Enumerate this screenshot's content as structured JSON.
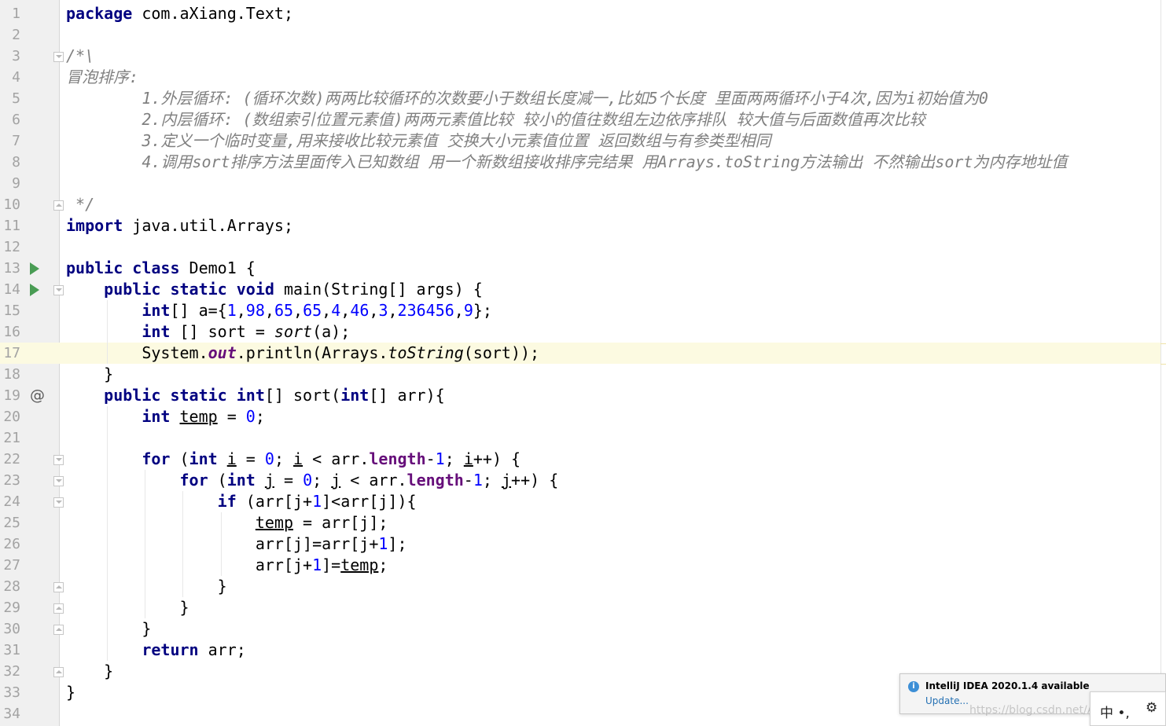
{
  "editor": {
    "language": "java",
    "current_line": 17,
    "lines": [
      {
        "n": "1",
        "t": "package com.aXiang.Text;"
      },
      {
        "n": "2",
        "t": ""
      },
      {
        "n": "3",
        "t": "/*\\"
      },
      {
        "n": "4",
        "t": "冒泡排序:"
      },
      {
        "n": "5",
        "t": "        1.外层循环: (循环次数)两两比较循环的次数要小于数组长度减一,比如5个长度 里面两两循环小于4次,因为i初始值为0"
      },
      {
        "n": "6",
        "t": "        2.内层循环: (数组索引位置元素值)两两元素值比较 较小的值往数组左边依序排队 较大值与后面数值再次比较"
      },
      {
        "n": "7",
        "t": "        3.定义一个临时变量,用来接收比较元素值 交换大小元素值位置 返回数组与有参类型相同"
      },
      {
        "n": "8",
        "t": "        4.调用sort排序方法里面传入已知数组 用一个新数组接收排序完结果 用Arrays.toString方法输出 不然输出sort为内存地址值"
      },
      {
        "n": "9",
        "t": ""
      },
      {
        "n": "10",
        "t": " */"
      },
      {
        "n": "11",
        "t": "import java.util.Arrays;"
      },
      {
        "n": "12",
        "t": ""
      },
      {
        "n": "13",
        "t": "public class Demo1 {"
      },
      {
        "n": "14",
        "t": "    public static void main(String[] args) {"
      },
      {
        "n": "15",
        "t": "        int[] a={1,98,65,65,4,46,3,236456,9};"
      },
      {
        "n": "16",
        "t": "        int [] sort = sort(a);"
      },
      {
        "n": "17",
        "t": "        System.out.println(Arrays.toString(sort));"
      },
      {
        "n": "18",
        "t": "    }"
      },
      {
        "n": "19",
        "t": "    public static int[] sort(int[] arr){"
      },
      {
        "n": "20",
        "t": "        int temp = 0;"
      },
      {
        "n": "21",
        "t": ""
      },
      {
        "n": "22",
        "t": "        for (int i = 0; i < arr.length-1; i++) {"
      },
      {
        "n": "23",
        "t": "            for (int j = 0; j < arr.length-1; j++) {"
      },
      {
        "n": "24",
        "t": "                if (arr[j+1]<arr[j]){"
      },
      {
        "n": "25",
        "t": "                    temp = arr[j];"
      },
      {
        "n": "26",
        "t": "                    arr[j]=arr[j+1];"
      },
      {
        "n": "27",
        "t": "                    arr[j+1]=temp;"
      },
      {
        "n": "28",
        "t": "                }"
      },
      {
        "n": "29",
        "t": "            }"
      },
      {
        "n": "30",
        "t": "        }"
      },
      {
        "n": "31",
        "t": "        return arr;"
      },
      {
        "n": "32",
        "t": "    }"
      },
      {
        "n": "33",
        "t": "}"
      },
      {
        "n": "34",
        "t": ""
      }
    ],
    "gutter_icons": [
      {
        "line": 13,
        "icon": "run-icon"
      },
      {
        "line": 14,
        "icon": "run-icon"
      },
      {
        "line": 19,
        "icon": "override-at-icon"
      }
    ]
  },
  "colors": {
    "keyword": "#000080",
    "number": "#0000ff",
    "comment": "#808080",
    "field": "#660e7a",
    "current_line_bg": "#fcfae1",
    "gutter_bg": "#f0f0f0",
    "run_icon": "#499c54"
  },
  "notification": {
    "icon": "info-icon",
    "title": "IntelliJ IDEA 2020.1.4 available",
    "link": "Update..."
  },
  "ime": {
    "text": "中 •, ",
    "icon": "gear-icon"
  },
  "watermark": "https://blog.csdn.net/AXiang"
}
